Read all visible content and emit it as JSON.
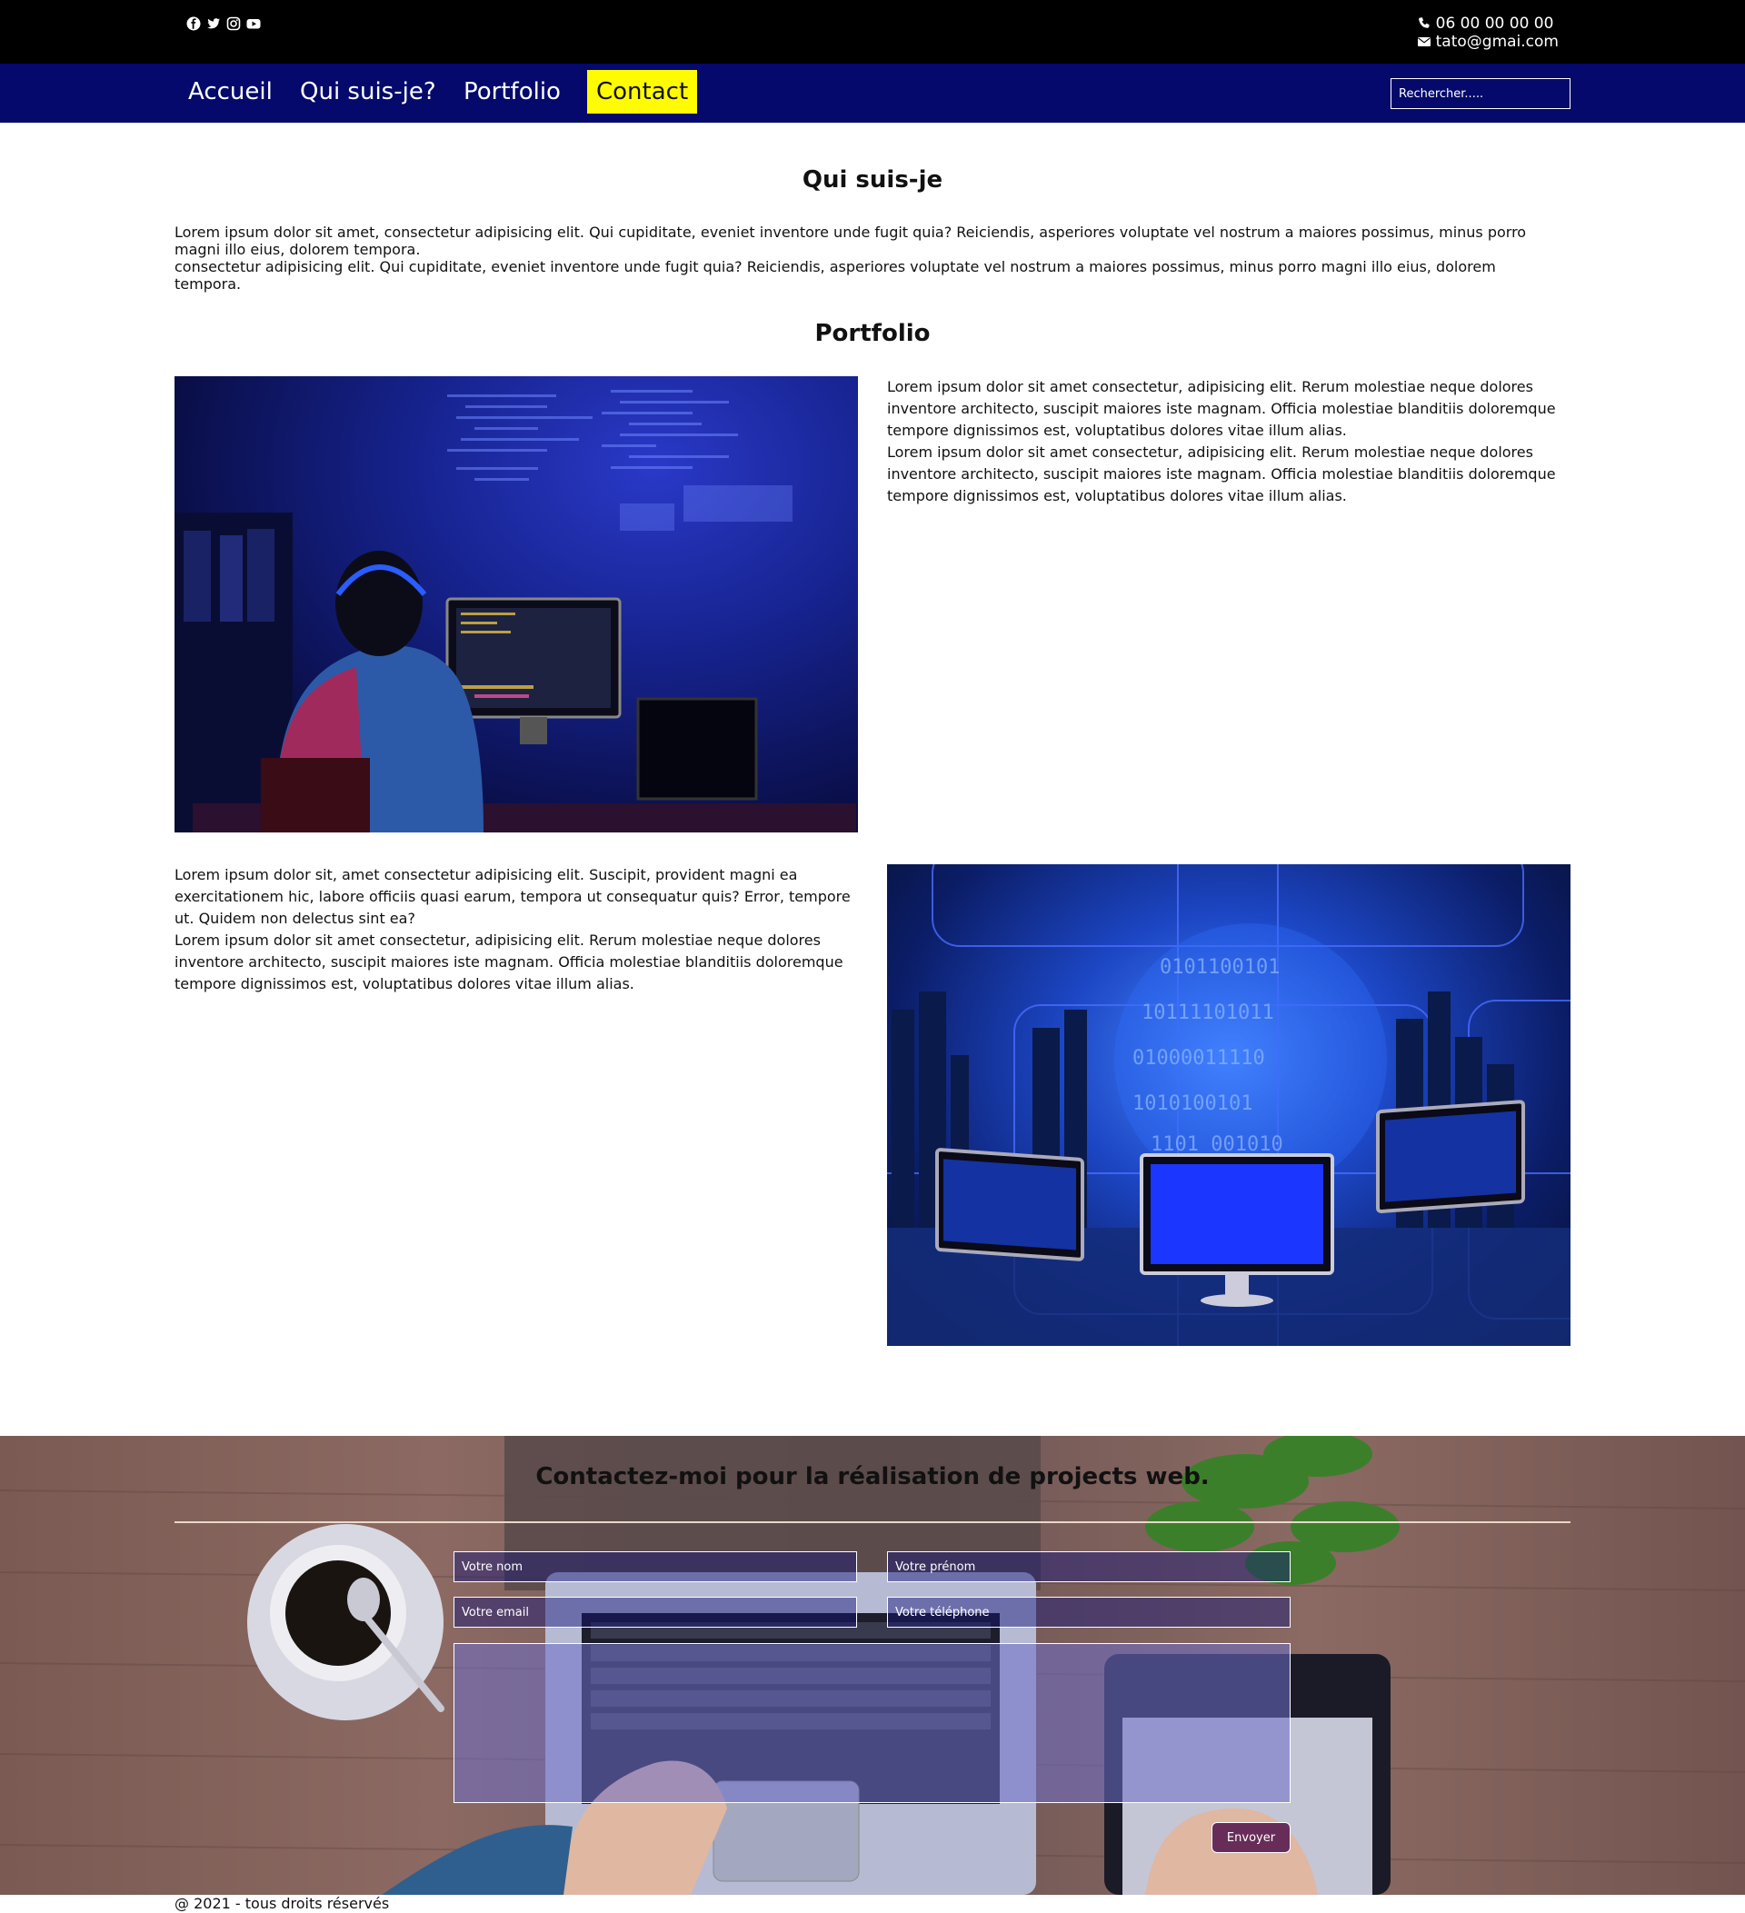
{
  "topbar": {
    "social_icons": [
      "facebook-icon",
      "twitter-icon",
      "instagram-icon",
      "youtube-icon"
    ],
    "phone": "06 00 00 00 00",
    "email": "tato@gmai.com"
  },
  "nav": {
    "items": [
      {
        "label": "Accueil",
        "active": false
      },
      {
        "label": "Qui suis-je?",
        "active": false
      },
      {
        "label": "Portfolio",
        "active": false
      },
      {
        "label": "Contact",
        "active": true
      }
    ],
    "search_placeholder": "Rechercher....."
  },
  "about": {
    "title": "Qui suis-je",
    "line1": "Lorem ipsum dolor sit amet, consectetur adipisicing elit. Qui cupiditate, eveniet inventore unde fugit quia? Reiciendis, asperiores voluptate vel nostrum a maiores possimus, minus porro",
    "line2": "magni illo eius, dolorem tempora.",
    "line3": "consectetur adipisicing elit. Qui cupiditate, eveniet inventore unde fugit quia? Reiciendis, asperiores voluptate vel nostrum a maiores possimus, minus porro magni illo eius, dolorem",
    "line4": "tempora."
  },
  "portfolio": {
    "title": "Portfolio",
    "block1": [
      "Lorem ipsum dolor sit amet consectetur, adipisicing elit. Rerum molestiae neque dolores",
      "inventore architecto, suscipit maiores iste magnam. Officia molestiae blanditiis doloremque",
      "tempore dignissimos est, voluptatibus dolores vitae illum alias.",
      "Lorem ipsum dolor sit amet consectetur, adipisicing elit. Rerum molestiae neque dolores",
      "inventore architecto, suscipit maiores iste magnam. Officia molestiae blanditiis doloremque",
      "tempore dignissimos est, voluptatibus dolores vitae illum alias."
    ],
    "block2": [
      "Lorem ipsum dolor sit, amet consectetur adipisicing elit. Suscipit, provident magni ea",
      "exercitationem hic, labore officiis quasi earum, tempora ut consequatur quis? Error, tempore",
      "ut. Quidem non delectus sint ea?",
      "Lorem ipsum dolor sit amet consectetur, adipisicing elit. Rerum molestiae neque dolores",
      "inventore architecto, suscipit maiores iste magnam. Officia molestiae blanditiis doloremque",
      "tempore dignissimos est, voluptatibus dolores vitae illum alias."
    ]
  },
  "contact": {
    "title": "Contactez-moi pour la réalisation de projects web.",
    "nom_placeholder": "Votre nom",
    "prenom_placeholder": "Votre prénom",
    "email_placeholder": "Votre email",
    "telephone_placeholder": "Votre téléphone",
    "submit_label": "Envoyer"
  },
  "footer": {
    "text": "@ 2021 - tous droits réservés"
  }
}
